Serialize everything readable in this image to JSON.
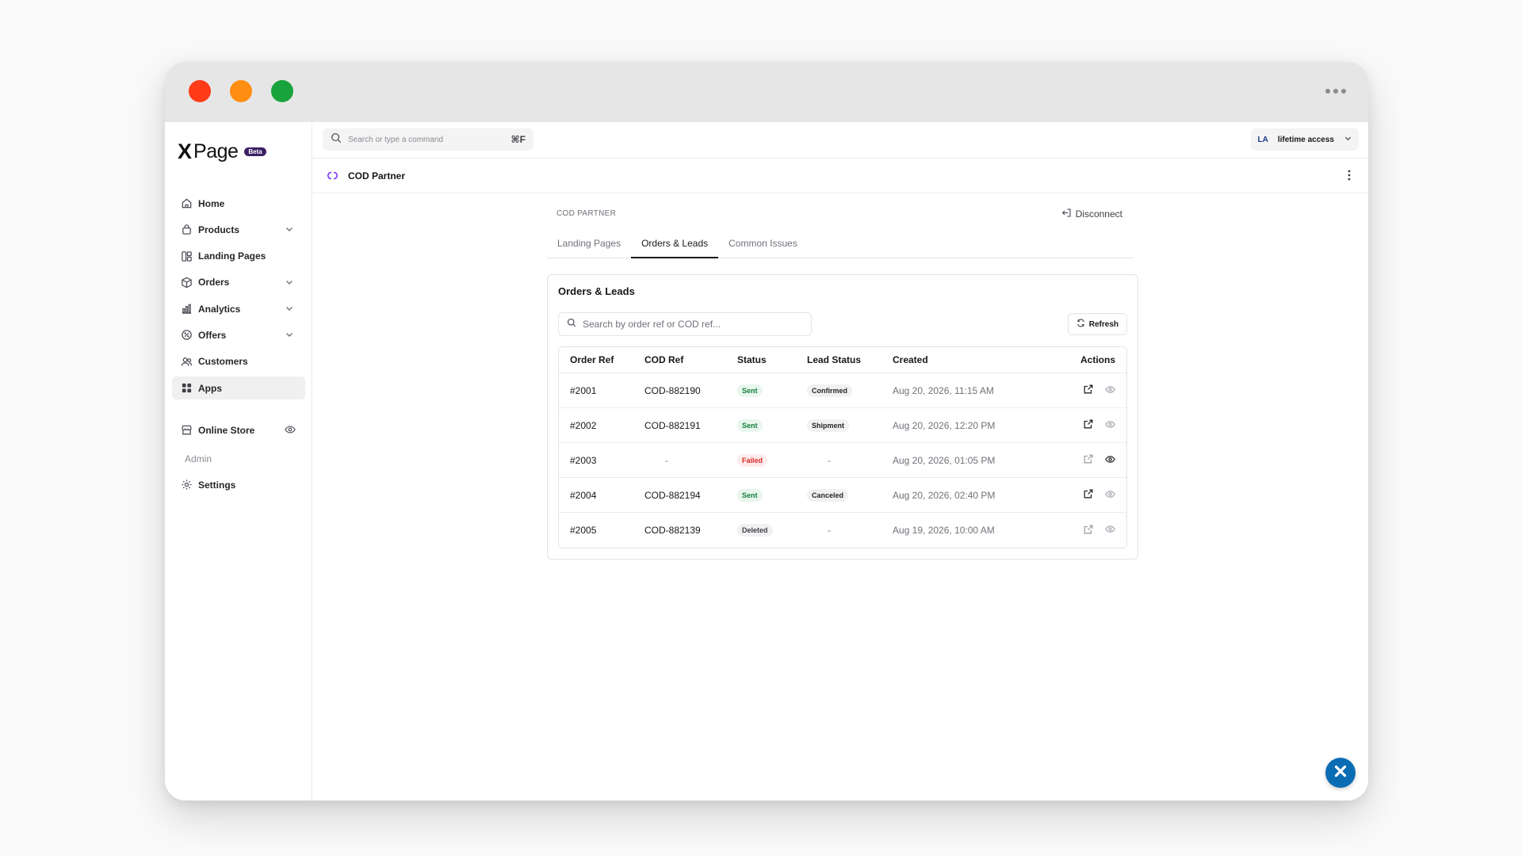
{
  "brand": {
    "logo_x": "X",
    "logo_text": "Page",
    "badge": "Beta"
  },
  "sidebar": {
    "items": [
      {
        "label": "Home",
        "icon": "home-icon"
      },
      {
        "label": "Products",
        "icon": "bag-icon",
        "expandable": true
      },
      {
        "label": "Landing Pages",
        "icon": "layout-icon"
      },
      {
        "label": "Orders",
        "icon": "box-icon",
        "expandable": true
      },
      {
        "label": "Analytics",
        "icon": "chart-icon",
        "expandable": true
      },
      {
        "label": "Offers",
        "icon": "percent-icon",
        "expandable": true
      },
      {
        "label": "Customers",
        "icon": "users-icon"
      },
      {
        "label": "Apps",
        "icon": "grid-icon",
        "active": true
      }
    ],
    "online_store": "Online Store",
    "admin_label": "Admin",
    "settings": "Settings"
  },
  "topbar": {
    "search_placeholder": "Search or type a command",
    "shortcut": "⌘F",
    "account_initials": "LA",
    "account_plan": "lifetime access"
  },
  "subheader": {
    "app_name": "COD Partner"
  },
  "content": {
    "section_label": "COD PARTNER",
    "disconnect": "Disconnect",
    "tabs": [
      "Landing Pages",
      "Orders & Leads",
      "Common Issues"
    ],
    "active_tab": "Orders & Leads"
  },
  "card": {
    "title": "Orders & Leads",
    "search_placeholder": "Search by order ref or COD ref...",
    "refresh": "Refresh",
    "columns": [
      "Order Ref",
      "COD Ref",
      "Status",
      "Lead Status",
      "Created",
      "Actions"
    ],
    "rows": [
      {
        "order_ref": "#2001",
        "cod_ref": "COD-882190",
        "status": "Sent",
        "lead_status": "Confirmed",
        "created": "Aug 20, 2026, 11:15 AM"
      },
      {
        "order_ref": "#2002",
        "cod_ref": "COD-882191",
        "status": "Sent",
        "lead_status": "Shipment",
        "created": "Aug 20, 2026, 12:20 PM"
      },
      {
        "order_ref": "#2003",
        "cod_ref": "-",
        "status": "Failed",
        "lead_status": "-",
        "created": "Aug 20, 2026, 01:05 PM"
      },
      {
        "order_ref": "#2004",
        "cod_ref": "COD-882194",
        "status": "Sent",
        "lead_status": "Canceled",
        "created": "Aug 20, 2026, 02:40 PM"
      },
      {
        "order_ref": "#2005",
        "cod_ref": "COD-882139",
        "status": "Deleted",
        "lead_status": "-",
        "created": "Aug 19, 2026, 10:00 AM"
      }
    ]
  },
  "colors": {
    "accent": "#0a6db4",
    "sent": "#15803d",
    "failed": "#dc2626",
    "beta_badge": "#3b1f63"
  }
}
